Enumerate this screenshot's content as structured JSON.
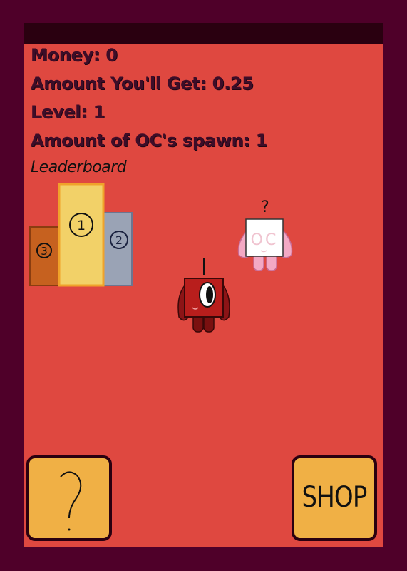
{
  "stats": {
    "money": "Money: 0",
    "amount": "Amount You'll Get: 0.25",
    "level": "Level: 1",
    "spawn": "Amount of OC's spawn: 1"
  },
  "leaderboard": {
    "label": "Leaderboard",
    "first": "1",
    "second": "2",
    "third": "3"
  },
  "buttons": {
    "help_icon": "question-mark",
    "shop_label": "SHOP"
  },
  "characters": {
    "mystery_text": "OC",
    "mystery_mark": "?"
  },
  "colors": {
    "background": "#df4840",
    "frame": "#4f0029",
    "gold": "#f2d168",
    "silver": "#9aa3b5",
    "bronze": "#c6611f",
    "button": "#f0b045"
  }
}
